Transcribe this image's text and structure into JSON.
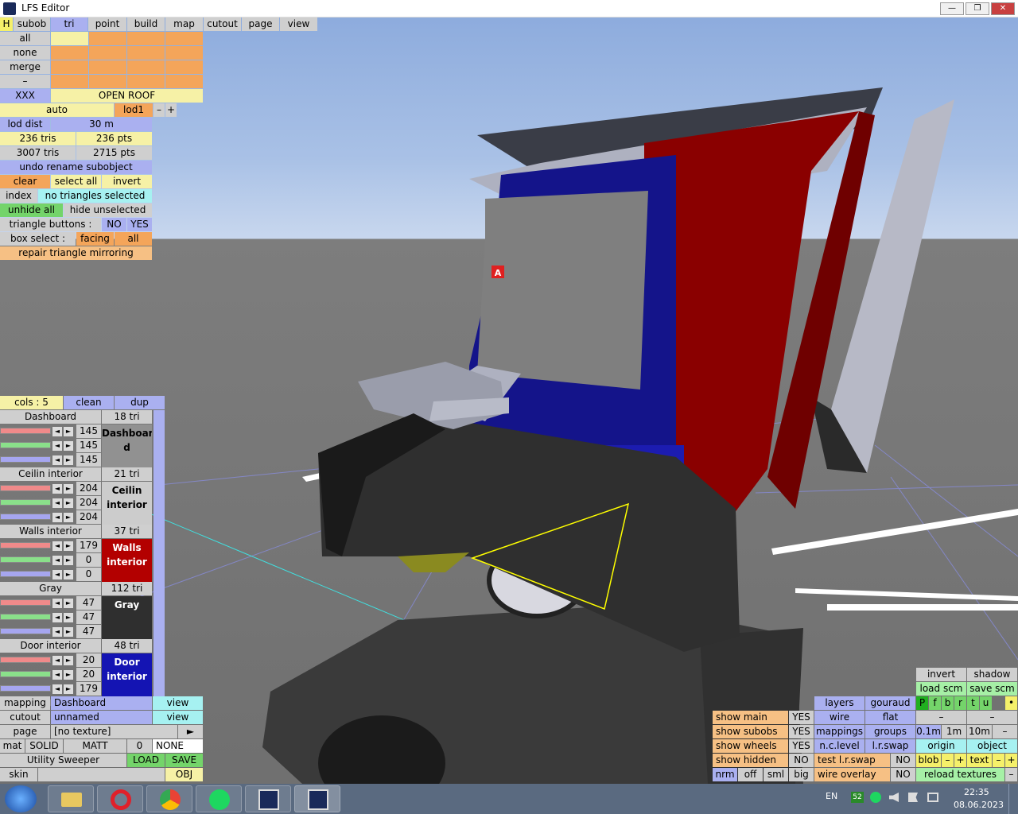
{
  "window": {
    "title": "LFS Editor",
    "btn_min": "—",
    "btn_restore": "❐",
    "btn_close": "✕"
  },
  "menu": {
    "h": "H",
    "items": [
      "subob",
      "tri",
      "point",
      "build",
      "map",
      "cutout",
      "page",
      "view"
    ]
  },
  "left_panel": {
    "all": "all",
    "none": "none",
    "merge": "merge",
    "dash": "–",
    "xxx": "XXX",
    "open_roof": "OPEN ROOF",
    "auto": "auto",
    "lod1": "lod1",
    "minus": "–",
    "plus": "+",
    "lod_dist": "lod dist",
    "lod_val": "30 m",
    "tris": "236 tris",
    "pts": "236 pts",
    "tris_total": "3007 tris",
    "pts_total": "2715 pts",
    "undo": "undo rename subobject",
    "clear": "clear",
    "select_all": "select all",
    "invert": "invert",
    "index": "index",
    "no_tri": "no triangles selected",
    "unhide_all": "unhide all",
    "hide_unselected": "hide unselected",
    "tri_buttons": "triangle buttons :",
    "no": "NO",
    "yes": "YES",
    "box_select": "box select :",
    "facing": "facing",
    "all2": "all",
    "repair": "repair triangle mirroring"
  },
  "colors_panel": {
    "cols": "cols : 5",
    "clean": "clean",
    "dup": "dup",
    "items": [
      {
        "name": "Dashboard",
        "count": "18 tri",
        "r": "145",
        "g": "145",
        "b": "145",
        "tex": "Dashboar d",
        "bg": "#919191",
        "fg": "#000000"
      },
      {
        "name": "Ceilin interior",
        "count": "21 tri",
        "r": "204",
        "g": "204",
        "b": "204",
        "tex": "Ceilin interior",
        "bg": "#cccccc",
        "fg": "#000000"
      },
      {
        "name": "Walls interior",
        "count": "37 tri",
        "r": "179",
        "g": "0",
        "b": "0",
        "tex": "Walls interior",
        "bg": "#b30000",
        "fg": "#ffffff"
      },
      {
        "name": "Gray",
        "count": "112 tri",
        "r": "47",
        "g": "47",
        "b": "47",
        "tex": "Gray",
        "bg": "#2f2f2f",
        "fg": "#ffffff"
      },
      {
        "name": "Door interior",
        "count": "48 tri",
        "r": "20",
        "g": "20",
        "b": "179",
        "tex": "Door interior",
        "bg": "#1414b3",
        "fg": "#ffffff"
      }
    ]
  },
  "bottom_left": {
    "mapping": "mapping",
    "mapping_val": "Dashboard",
    "view": "view",
    "cutout": "cutout",
    "cutout_val": "unnamed",
    "view2": "view",
    "page": "page",
    "page_val": "[no texture]",
    "arrow": "►",
    "mat": "mat",
    "solid": "SOLID",
    "matt": "MATT",
    "zero": "0",
    "none": "NONE",
    "utility": "Utility Sweeper",
    "load": "LOAD",
    "save": "SAVE",
    "skin": "skin",
    "obj": "OBJ"
  },
  "bottom_right": {
    "invert": "invert",
    "shadow": "shadow",
    "load_scm": "load scm",
    "save_scm": "save scm",
    "pflags": [
      "P",
      "f",
      "b",
      "r",
      "t",
      "u",
      "•"
    ],
    "layers": "layers",
    "gouraud": "gouraud",
    "wire": "wire",
    "flat": "flat",
    "mappings": "mappings",
    "groups": "groups",
    "nc_level": "n.c.level",
    "lr_swap": "l.r.swap",
    "d1": "–",
    "d2": "–",
    "m01": "0.1m",
    "m1": "1m",
    "m10": "10m",
    "mm": "–",
    "origin": "origin",
    "object": "object",
    "show_main": "show main",
    "show_main_v": "YES",
    "show_subobs": "show subobs",
    "show_subobs_v": "YES",
    "show_wheels": "show wheels",
    "show_wheels_v": "YES",
    "show_hidden": "show hidden",
    "show_hidden_v": "NO",
    "test_lr": "test l.r.swap",
    "test_lr_v": "NO",
    "wire_overlay": "wire overlay",
    "wire_overlay_v": "NO",
    "blob": "blob",
    "text": "text",
    "bm": "–",
    "bp": "+",
    "tm": "–",
    "tp": "+",
    "reload": "reload textures",
    "rl": "–",
    "nrm": "nrm",
    "off": "off",
    "sml": "sml",
    "big": "big"
  },
  "marker": "A",
  "taskbar": {
    "lang": "EN",
    "badge": "52",
    "time": "22:35",
    "date": "08.06.2023"
  }
}
